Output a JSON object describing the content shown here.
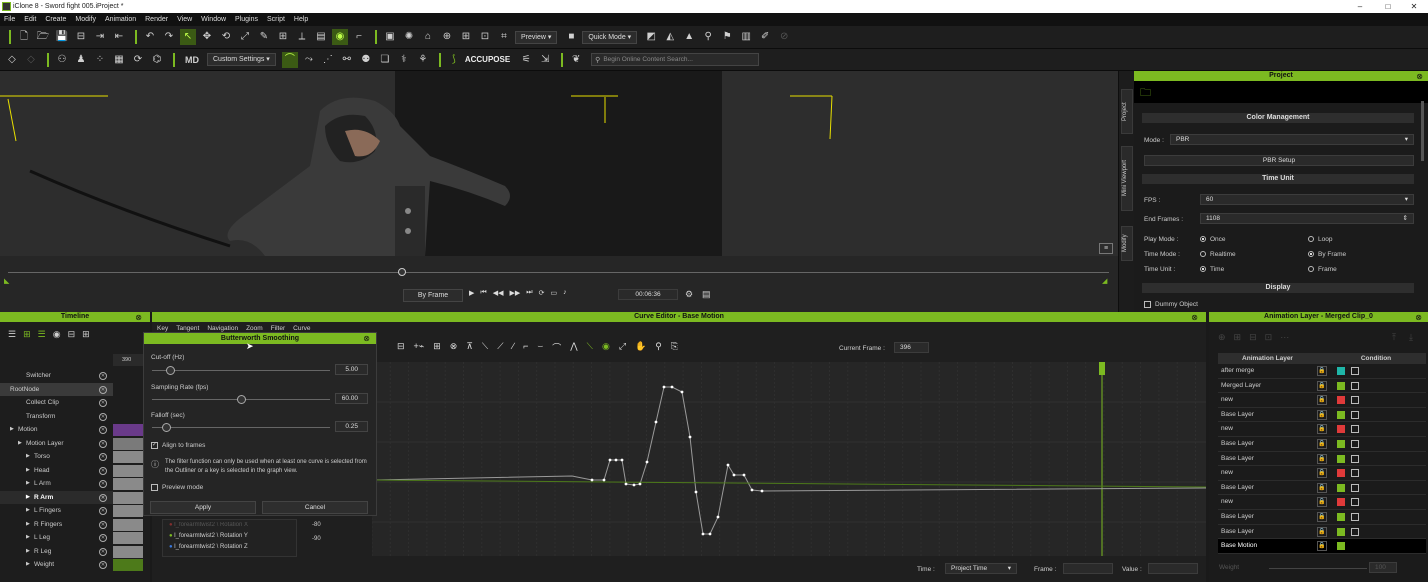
{
  "window": {
    "title": "iClone 8 - Sword fight 005.iProject *",
    "min": "–",
    "max": "□",
    "close": "✕"
  },
  "menu": [
    "File",
    "Edit",
    "Create",
    "Modify",
    "Animation",
    "Render",
    "View",
    "Window",
    "Plugins",
    "Script",
    "Help"
  ],
  "toolbar1": {
    "preview": "Preview ▾",
    "quickmode": "Quick Mode ▾"
  },
  "toolbar2": {
    "custom_settings": "Custom Settings ▾",
    "accupose": "ACCUPOSE",
    "search_placeholder": "Begin Online Content Search...",
    "logo": "MD"
  },
  "viewport": {
    "frame_mode": "By Frame",
    "time": "00:06:36"
  },
  "side_tabs": [
    "Project",
    "Mini Viewport",
    "Modify"
  ],
  "project": {
    "title": "Project",
    "color_mgmt": "Color Management",
    "mode_label": "Mode :",
    "mode_value": "PBR",
    "pbr_setup": "PBR Setup",
    "time_unit_hdr": "Time Unit",
    "fps_label": "FPS :",
    "fps_value": "60",
    "end_frames_label": "End Frames :",
    "end_frames_value": "1108",
    "play_mode_label": "Play Mode :",
    "play_once": "Once",
    "play_loop": "Loop",
    "time_mode_label": "Time Mode :",
    "time_realtime": "Realtime",
    "time_byframe": "By Frame",
    "time_unit_label": "Time Unit :",
    "unit_time": "Time",
    "unit_frame": "Frame",
    "display_hdr": "Display",
    "dummy_object": "Dummy Object"
  },
  "timeline": {
    "title": "Timeline",
    "frame": "390",
    "rows": [
      {
        "label": "Switcher",
        "indent": 20
      },
      {
        "label": "RootNode",
        "indent": 4,
        "sel": "root"
      },
      {
        "label": "Collect Clip",
        "indent": 20
      },
      {
        "label": "Transform",
        "indent": 20
      },
      {
        "label": "Motion",
        "indent": 12
      },
      {
        "label": "Motion Layer",
        "indent": 20
      },
      {
        "label": "Torso",
        "indent": 28
      },
      {
        "label": "Head",
        "indent": 28
      },
      {
        "label": "L Arm",
        "indent": 28
      },
      {
        "label": "R Arm",
        "indent": 28,
        "sel": "sel"
      },
      {
        "label": "L Fingers",
        "indent": 28
      },
      {
        "label": "R Fingers",
        "indent": 28
      },
      {
        "label": "L Leg",
        "indent": 28
      },
      {
        "label": "R Leg",
        "indent": 28
      },
      {
        "label": "Weight",
        "indent": 28
      }
    ]
  },
  "curve_editor": {
    "title": "Curve Editor - Base Motion",
    "menu": [
      "Key",
      "Tangent",
      "Navigation",
      "Zoom",
      "Filter",
      "Curve"
    ],
    "current_frame_label": "Current Frame :",
    "current_frame": "396",
    "ruler": [
      "357",
      "358",
      "359",
      "360",
      "361",
      "362",
      "363",
      "364",
      "365",
      "366",
      "367",
      "368",
      "369",
      "370",
      "371",
      "372",
      "373",
      "374",
      "375",
      "376",
      "377",
      "378",
      "379",
      "380",
      "381",
      "382",
      "383",
      "384",
      "385",
      "386",
      "387",
      "388",
      "389",
      "390",
      "391",
      "392",
      "393",
      "394",
      "395",
      "396",
      "397",
      "398",
      "399",
      "400",
      "4"
    ],
    "y_ticks": [
      "-80",
      "-90"
    ],
    "curves": [
      "l_forearmtwist2 \\ Rotation X",
      "l_forearmtwist2 \\ Rotation Y",
      "l_forearmtwist2 \\ Rotation Z"
    ],
    "time_label": "Time :",
    "time_value": "Project Time",
    "frame_label": "Frame :",
    "value_label": "Value :"
  },
  "butterworth": {
    "title": "Butterworth Smoothing",
    "cutoff_label": "Cut-off (Hz)",
    "cutoff_value": "5.00",
    "cutoff_frac": 0.1,
    "sampling_label": "Sampling Rate (fps)",
    "sampling_value": "60.00",
    "sampling_frac": 0.5,
    "falloff_label": "Falloff (sec)",
    "falloff_value": "0.25",
    "falloff_frac": 0.08,
    "align_label": "Align to frames",
    "info": "The filter function can only be used when at least one curve is selected from the Outliner or a key is selected in the graph view.",
    "preview_label": "Preview mode",
    "apply": "Apply",
    "cancel": "Cancel"
  },
  "anim_layer": {
    "title": "Animation Layer - Merged Clip_0",
    "col_layer": "Animation Layer",
    "col_condition": "Condition",
    "weight_label": "Weight",
    "weight_value": "100",
    "rows": [
      {
        "name": "after merge",
        "color": "#1fb6a8"
      },
      {
        "name": "Merged Layer",
        "color": "#7cba21"
      },
      {
        "name": "new",
        "color": "#e03a3a"
      },
      {
        "name": "Base Layer",
        "color": "#7cba21"
      },
      {
        "name": "new",
        "color": "#e03a3a"
      },
      {
        "name": "Base Layer",
        "color": "#7cba21"
      },
      {
        "name": "Base Layer",
        "color": "#7cba21"
      },
      {
        "name": "new",
        "color": "#e03a3a"
      },
      {
        "name": "Base Layer",
        "color": "#7cba21"
      },
      {
        "name": "new",
        "color": "#e03a3a"
      },
      {
        "name": "Base Layer",
        "color": "#7cba21"
      },
      {
        "name": "Base Layer",
        "color": "#7cba21"
      },
      {
        "name": "Base Motion",
        "color": "#7cba21",
        "sel": true
      }
    ]
  },
  "colors": {
    "accent": "#7cba21",
    "panel": "#1b1b1b"
  },
  "icons": {
    "play": "▶",
    "first": "⏮",
    "prev": "◀◀",
    "next": "▶▶",
    "last": "⏭",
    "gear": "⚙",
    "info": "ⓘ",
    "close": "⊗",
    "search": "🔍"
  }
}
